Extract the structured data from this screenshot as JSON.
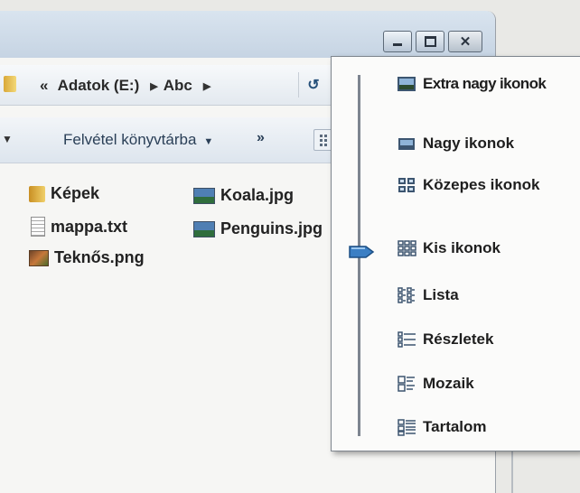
{
  "window": {
    "caption_buttons": {
      "minimize_icon": "minimize-icon",
      "maximize_icon": "maximize-icon",
      "close_icon": "close-icon",
      "close_glyph": "✕"
    }
  },
  "address_bar": {
    "overflow_glyph": "«",
    "crumbs": [
      "Adatok (E:)",
      "Abc"
    ],
    "separator_glyph": "▶",
    "refresh_glyph": "↺"
  },
  "toolbar": {
    "left_arrow_glyph": "▼",
    "library_label": "Felvétel könyvtárba",
    "library_caret": "▼",
    "more_glyph": "»"
  },
  "files": [
    {
      "name": "Képek",
      "icon": "folder-icon"
    },
    {
      "name": "mappa.txt",
      "icon": "text-file-icon"
    },
    {
      "name": "Teknős.png",
      "icon": "image-file-icon"
    },
    {
      "name": "Koala.jpg",
      "icon": "image-file-icon"
    },
    {
      "name": "Penguins.jpg",
      "icon": "image-file-icon"
    }
  ],
  "view_menu": {
    "selected": "Kis ikonok",
    "items": [
      {
        "label": "Extra nagy ikonok",
        "icon": "extra-large-icons-icon"
      },
      {
        "label": "Nagy ikonok",
        "icon": "large-icons-icon"
      },
      {
        "label": "Közepes ikonok",
        "icon": "medium-icons-icon"
      },
      {
        "label": "Kis ikonok",
        "icon": "small-icons-icon"
      },
      {
        "label": "Lista",
        "icon": "list-icon"
      },
      {
        "label": "Részletek",
        "icon": "details-icon"
      },
      {
        "label": "Mozaik",
        "icon": "tiles-icon"
      },
      {
        "label": "Tartalom",
        "icon": "content-icon"
      }
    ]
  },
  "colors": {
    "titlebar": "#c6d4e3",
    "slider_thumb": "#3b7fc4"
  }
}
